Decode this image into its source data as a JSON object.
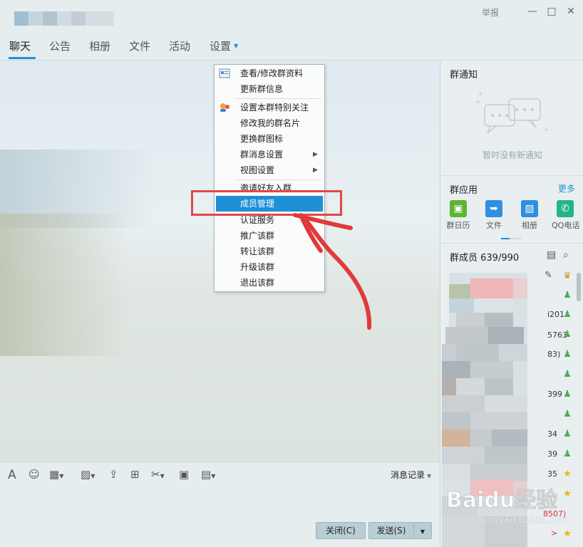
{
  "title_bar": {
    "report": "举报"
  },
  "tabs": [
    {
      "label": "聊天",
      "active": true
    },
    {
      "label": "公告"
    },
    {
      "label": "相册"
    },
    {
      "label": "文件"
    },
    {
      "label": "活动"
    },
    {
      "label": "设置"
    }
  ],
  "settings_menu": {
    "items": [
      {
        "label": "查看/修改群资料",
        "icon": "group-card-icon"
      },
      {
        "label": "更新群信息"
      },
      {
        "label": "设置本群特别关注",
        "icon": "special-follow-icon"
      },
      {
        "label": "修改我的群名片"
      },
      {
        "label": "更换群图标"
      },
      {
        "label": "群消息设置",
        "submenu": true
      },
      {
        "label": "视图设置",
        "submenu": true
      },
      {
        "label": "邀请好友入群"
      },
      {
        "label": "成员管理",
        "selected": true
      },
      {
        "label": "认证服务"
      },
      {
        "label": "推广该群"
      },
      {
        "label": "转让该群"
      },
      {
        "label": "升级该群"
      },
      {
        "label": "退出该群"
      }
    ]
  },
  "right_panel": {
    "notice_title": "群通知",
    "notice_empty": "暂时没有新通知",
    "apps_title": "群应用",
    "apps_more": "更多",
    "apps": [
      {
        "label": "群日历",
        "icon": "calendar-icon",
        "color": "#5cb531"
      },
      {
        "label": "文件",
        "icon": "folder-icon",
        "color": "#2f8fe0"
      },
      {
        "label": "相册",
        "icon": "photo-icon",
        "color": "#2f8fe0"
      },
      {
        "label": "QQ电话",
        "icon": "phone-icon",
        "color": "#25b38a"
      }
    ],
    "members_title": "群成员 639/990",
    "member_fragments": [
      "i201",
      "5763",
      "83)",
      "399",
      "34",
      "39",
      "35",
      "8507)",
      ">"
    ]
  },
  "toolbar": {
    "message_history": "消息记录"
  },
  "buttons": {
    "close": "关闭(C)",
    "send": "发送(S)"
  },
  "watermark": {
    "brand": "Baidu经验",
    "url": "jingyan.baidu.com"
  },
  "colors": {
    "accent": "#1f8fd6",
    "highlight_box": "#e04848"
  }
}
